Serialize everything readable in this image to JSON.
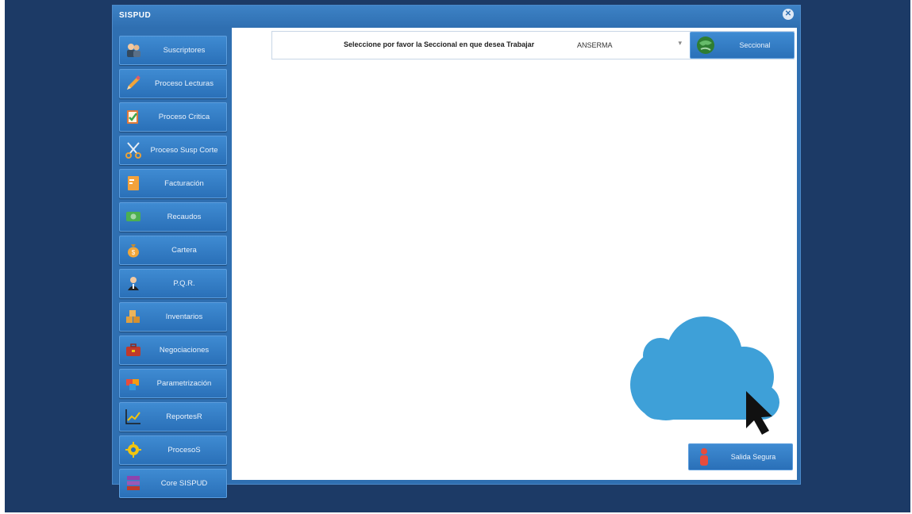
{
  "window": {
    "title": "SISPUD",
    "close_icon": "close-icon",
    "colors": {
      "frame": "#2f6fb1",
      "desktop": "#1c3a66",
      "button": "#2f78c2",
      "cloud": "#3ea0d8"
    }
  },
  "sidebar": {
    "items": [
      {
        "label": "Suscriptores",
        "icon": "subscribers-icon"
      },
      {
        "label": "Proceso Lecturas",
        "icon": "pencil-icon"
      },
      {
        "label": "Proceso Critica",
        "icon": "checklist-icon"
      },
      {
        "label": "Proceso Susp Corte",
        "icon": "scissors-icon"
      },
      {
        "label": "Facturación",
        "icon": "invoice-icon"
      },
      {
        "label": "Recaudos",
        "icon": "money-icon"
      },
      {
        "label": "Cartera",
        "icon": "money-bag-icon"
      },
      {
        "label": "P.Q.R.",
        "icon": "person-icon"
      },
      {
        "label": "Inventarios",
        "icon": "boxes-icon"
      },
      {
        "label": "Negociaciones",
        "icon": "briefcase-icon"
      },
      {
        "label": "Parametrización",
        "icon": "puzzle-icon"
      },
      {
        "label": "ReportesR",
        "icon": "chart-icon"
      },
      {
        "label": "ProcesoS",
        "icon": "gear-icon"
      },
      {
        "label": "Core SISPUD",
        "icon": "server-icon"
      }
    ]
  },
  "header": {
    "prompt": "Seleccione por favor la Seccional en que desea Trabajar",
    "seccional_value": "ANSERMA",
    "button_label": "Seccional",
    "button_icon": "globe-icon"
  },
  "footer": {
    "exit_label": "Salida Segura",
    "exit_icon": "exit-person-icon"
  }
}
